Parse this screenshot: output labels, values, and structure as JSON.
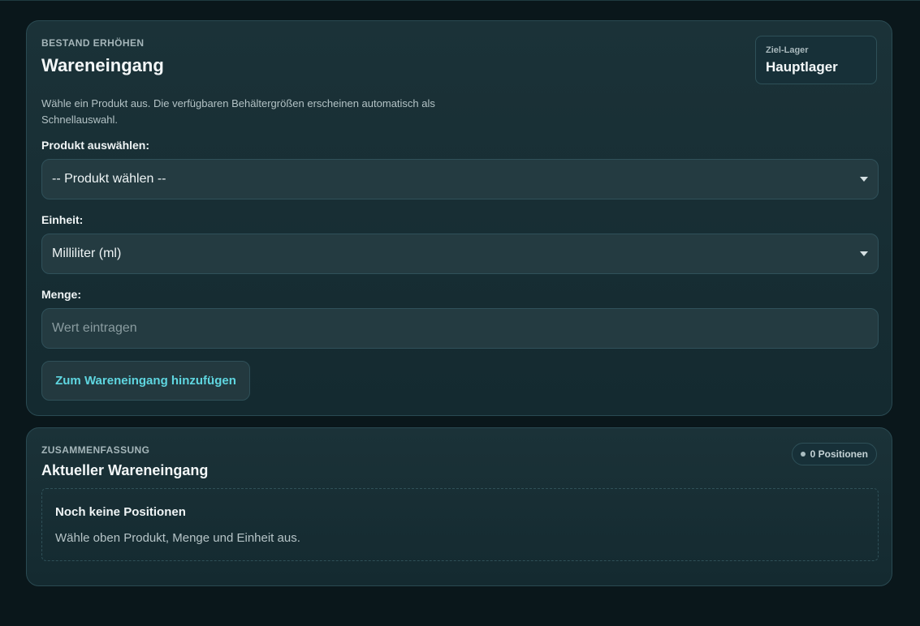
{
  "intake": {
    "eyebrow": "BESTAND ERHÖHEN",
    "title": "Wareneingang",
    "target_label": "Ziel-Lager",
    "target_value": "Hauptlager",
    "description": "Wähle ein Produkt aus. Die verfügbaren Behältergrößen erscheinen automatisch als Schnellauswahl.",
    "product_label": "Produkt auswählen:",
    "product_value": "-- Produkt wählen --",
    "unit_label": "Einheit:",
    "unit_value": "Milliliter (ml)",
    "quantity_label": "Menge:",
    "quantity_placeholder": "Wert eintragen",
    "add_button_label": "Zum Wareneingang hinzufügen"
  },
  "summary": {
    "eyebrow": "ZUSAMMENFASSUNG",
    "title": "Aktueller Wareneingang",
    "count_badge": "0 Positionen",
    "empty_title": "Noch keine Positionen",
    "empty_text": "Wähle oben Produkt, Menge und Einheit aus."
  },
  "colors": {
    "background": "#0a171b",
    "card": "#1b3238",
    "accent": "#5fd6e0"
  }
}
